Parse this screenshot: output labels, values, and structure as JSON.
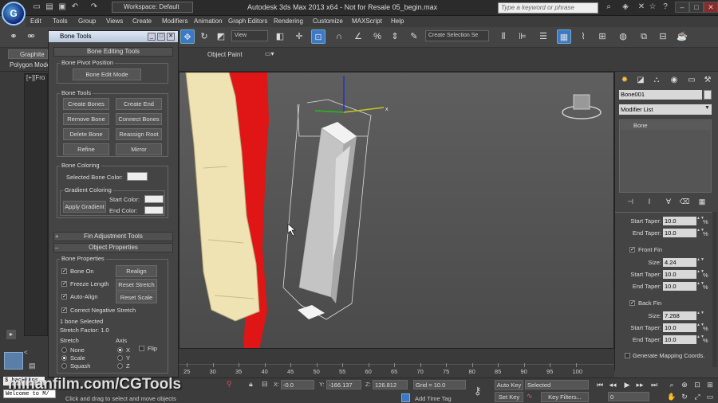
{
  "title_bar": {
    "logo": "3ds-max-logo",
    "workspace_label": "Workspace: Default",
    "window_title": "Autodesk 3ds Max  2013 x64   -  Not for Resale     05_begin.max",
    "search_placeholder": "Type a keyword or phrase"
  },
  "menu": [
    "Edit",
    "Tools",
    "Group",
    "Views",
    "Create",
    "Modifiers",
    "Animation",
    "Graph Editors",
    "Rendering",
    "Customize",
    "MAXScript",
    "Help"
  ],
  "toolbar": {
    "view_dropdown": "View",
    "selection_set": "Create Selection Se"
  },
  "ribbon": {
    "tab_graphite": "Graphite",
    "tab_polygon": "Polygon Mode",
    "tab_object_paint": "Object Paint"
  },
  "viewport": {
    "label": "[+][Fro"
  },
  "dialog": {
    "title": "Bone Tools",
    "rollout_bone_editing": "Bone Editing Tools",
    "group_pivot": "Bone Pivot Position",
    "btn_edit_mode": "Bone Edit Mode",
    "group_tools": "Bone Tools",
    "btn_create_bones": "Create Bones",
    "btn_create_end": "Create End",
    "btn_remove_bone": "Remove Bone",
    "btn_connect_bones": "Connect Bones",
    "btn_delete_bone": "Delete Bone",
    "btn_reassign_root": "Reassign Root",
    "btn_refine": "Refine",
    "btn_mirror": "Mirror",
    "group_coloring": "Bone Coloring",
    "selected_color_label": "Selected Bone Color:",
    "group_gradient": "Gradient Coloring",
    "btn_apply_gradient": "Apply Gradient",
    "start_color_label": "Start Color:",
    "end_color_label": "End Color:",
    "rollout_fin": "Fin Adjustment Tools",
    "rollout_object": "Object Properties",
    "group_bone_props": "Bone Properties",
    "bone_on": "Bone On",
    "btn_realign": "Realign",
    "freeze_length": "Freeze Length",
    "btn_reset_stretch": "Reset Stretch",
    "auto_align": "Auto-Align",
    "btn_reset_scale": "Reset Scale",
    "correct_negative": "Correct Negative Stretch",
    "selected_count": "1 bone Selected",
    "stretch_factor": "Stretch Factor: 1.0",
    "stretch_label": "Stretch",
    "stretch_none": "None",
    "stretch_scale": "Scale",
    "stretch_squash": "Squash",
    "axis_label": "Axis",
    "axis_x": "X",
    "axis_y": "Y",
    "axis_z": "Z",
    "flip_label": "Flip"
  },
  "command_panel": {
    "object_name": "Bone001",
    "modifier_list": "Modifier List",
    "stack_item": "Bone",
    "top": {
      "start_taper_label": "Start Taper:",
      "start_taper": "10.0",
      "end_taper_label": "End Taper:",
      "end_taper": "10.0"
    },
    "front_fin": {
      "label": "Front Fin",
      "size_label": "Size:",
      "size": "4.24",
      "start_taper_label": "Start Taper:",
      "start_taper": "10.0",
      "end_taper_label": "End Taper:",
      "end_taper": "10.0"
    },
    "back_fin": {
      "label": "Back Fin",
      "size_label": "Size:",
      "size": "7.268",
      "start_taper_label": "Start Taper:",
      "start_taper": "10.0",
      "end_taper_label": "End Taper:",
      "end_taper": "10.0"
    },
    "gen_mapping": "Generate Mapping Coords.",
    "percent": "%"
  },
  "timeline": {
    "ticks": [
      "25",
      "30",
      "35",
      "40",
      "45",
      "50",
      "55",
      "60",
      "65",
      "70",
      "75",
      "80",
      "85",
      "90",
      "95",
      "100"
    ]
  },
  "status": {
    "maxscript_1": "$.backFins",
    "maxscript_2": "Welcome to M/",
    "prompt": "Click and drag to select and move objects",
    "x_label": "X:",
    "x_value": "-0.0",
    "y_label": "Y:",
    "y_value": "-166.137",
    "z_label": "Z:",
    "z_value": "126.812",
    "grid": "Grid = 10.0",
    "add_time_tag": "Add Time Tag",
    "auto_key": "Auto Key",
    "selected_dropdown": "Selected",
    "set_key": "Set Key",
    "key_filters": "Key Filters...",
    "frame": "0"
  },
  "watermark": "mihanfilm.com/CGTools"
}
